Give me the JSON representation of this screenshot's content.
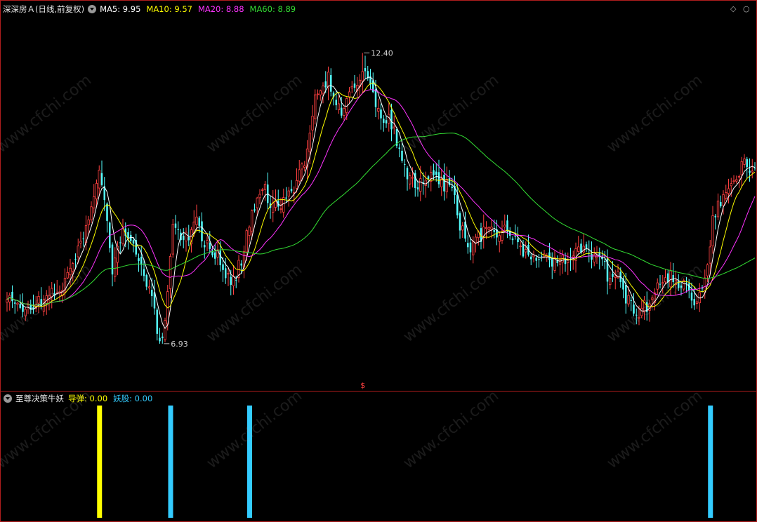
{
  "main_panel": {
    "stock_title": "深深房Ａ",
    "period_label": "(日线,前复权)",
    "ma_legend": [
      {
        "key": "ma5",
        "label": "MA5: 9.95",
        "color": "#ffffff"
      },
      {
        "key": "ma10",
        "label": "MA10: 9.57",
        "color": "#ffff00"
      },
      {
        "key": "ma20",
        "label": "MA20: 8.88",
        "color": "#ff33ff"
      },
      {
        "key": "ma60",
        "label": "MA60: 8.89",
        "color": "#33dd33"
      }
    ],
    "high_marker": "12.40",
    "low_marker": "6.93",
    "bottom_marker": "$",
    "corner_icons": [
      "◇",
      "○"
    ]
  },
  "indicator_panel": {
    "name": "至尊决策牛妖",
    "legend": [
      {
        "key": "daodan",
        "label": "导弹: 0.00",
        "color": "#ffff00"
      },
      {
        "key": "yaogu",
        "label": "妖股: 0.00",
        "color": "#33ccff"
      }
    ],
    "signals": [
      {
        "candle": 35,
        "series": "daodan",
        "value": 1
      },
      {
        "candle": 62,
        "series": "yaogu",
        "value": 1
      },
      {
        "candle": 92,
        "series": "yaogu",
        "value": 1
      },
      {
        "candle": 267,
        "series": "yaogu",
        "value": 1
      }
    ]
  },
  "watermark": "www.cfchi.com",
  "colors": {
    "up": "#ff4040",
    "down": "#54ffff",
    "frame": "#b01d1d",
    "bg": "#000000"
  },
  "chart_data": {
    "type": "candlestick",
    "ylim": [
      6.4,
      13.0
    ],
    "num_candles": 285,
    "anchors": [
      [
        0,
        7.75
      ],
      [
        6,
        7.6
      ],
      [
        12,
        7.7
      ],
      [
        20,
        7.95
      ],
      [
        26,
        8.5
      ],
      [
        31,
        9.3
      ],
      [
        35,
        10.3
      ],
      [
        38,
        9.1
      ],
      [
        40,
        8.35
      ],
      [
        44,
        9.0
      ],
      [
        49,
        8.7
      ],
      [
        52,
        8.1
      ],
      [
        55,
        7.75
      ],
      [
        58,
        6.95
      ],
      [
        60,
        7.4
      ],
      [
        63,
        9.2
      ],
      [
        66,
        8.9
      ],
      [
        70,
        9.05
      ],
      [
        72,
        9.3
      ],
      [
        75,
        8.8
      ],
      [
        80,
        8.6
      ],
      [
        85,
        8.0
      ],
      [
        89,
        8.5
      ],
      [
        93,
        9.35
      ],
      [
        97,
        9.9
      ],
      [
        100,
        9.6
      ],
      [
        104,
        9.55
      ],
      [
        109,
        9.9
      ],
      [
        114,
        10.5
      ],
      [
        117,
        11.5
      ],
      [
        122,
        11.95
      ],
      [
        127,
        11.2
      ],
      [
        130,
        11.65
      ],
      [
        135,
        12.05
      ],
      [
        138,
        11.7
      ],
      [
        142,
        11.1
      ],
      [
        145,
        11.25
      ],
      [
        150,
        10.3
      ],
      [
        154,
        9.95
      ],
      [
        158,
        9.9
      ],
      [
        162,
        10.15
      ],
      [
        166,
        9.9
      ],
      [
        169,
        10.0
      ],
      [
        172,
        9.15
      ],
      [
        175,
        8.75
      ],
      [
        178,
        8.85
      ],
      [
        181,
        9.0
      ],
      [
        185,
        9.0
      ],
      [
        190,
        9.05
      ],
      [
        193,
        8.85
      ],
      [
        198,
        8.55
      ],
      [
        203,
        8.6
      ],
      [
        208,
        8.45
      ],
      [
        214,
        8.55
      ],
      [
        218,
        8.7
      ],
      [
        222,
        8.6
      ],
      [
        225,
        8.7
      ],
      [
        229,
        8.05
      ],
      [
        232,
        8.2
      ],
      [
        235,
        7.75
      ],
      [
        240,
        7.55
      ],
      [
        244,
        7.7
      ],
      [
        247,
        8.05
      ],
      [
        251,
        8.2
      ],
      [
        254,
        8.1
      ],
      [
        258,
        8.0
      ],
      [
        262,
        7.6
      ],
      [
        265,
        8.1
      ],
      [
        268,
        9.2
      ],
      [
        272,
        9.8
      ],
      [
        276,
        10.1
      ],
      [
        280,
        10.3
      ],
      [
        284,
        10.25
      ]
    ],
    "extremes": {
      "high": {
        "candle": 135,
        "value": 12.4
      },
      "low": {
        "candle": 59,
        "value": 6.93
      }
    },
    "series": [
      {
        "name": "MA5",
        "period": 5,
        "color": "#ffffff"
      },
      {
        "name": "MA10",
        "period": 10,
        "color": "#ffff00"
      },
      {
        "name": "MA20",
        "period": 20,
        "color": "#ff33ff"
      },
      {
        "name": "MA60",
        "period": 60,
        "color": "#33dd33"
      }
    ]
  }
}
